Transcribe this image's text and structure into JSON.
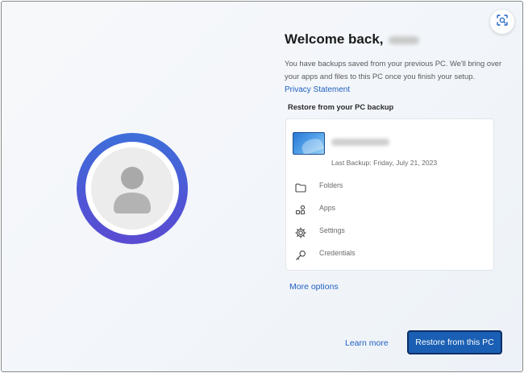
{
  "header": {
    "title": "Welcome back,",
    "user_name_redacted": true
  },
  "description": {
    "text": "You have backups saved from your previous PC. We'll bring over your apps and files to this PC once you finish your setup.",
    "privacy_link": "Privacy Statement"
  },
  "backup_section": {
    "label": "Restore from your PC backup",
    "device_name_redacted": true,
    "last_backup": "Last Backup: Friday, July 21, 2023",
    "items": [
      {
        "label": "Folders",
        "icon": "folder-icon"
      },
      {
        "label": "Apps",
        "icon": "apps-icon"
      },
      {
        "label": "Settings",
        "icon": "settings-gear-icon"
      },
      {
        "label": "Credentials",
        "icon": "key-icon"
      }
    ]
  },
  "links": {
    "more_options": "More options",
    "learn_more": "Learn more"
  },
  "actions": {
    "restore_label": "Restore from this PC"
  },
  "colors": {
    "accent": "#1a5fb4",
    "link": "#1f5fbf",
    "avatar_ring_start": "#3d6fd9",
    "avatar_ring_end": "#5a4bd1"
  }
}
